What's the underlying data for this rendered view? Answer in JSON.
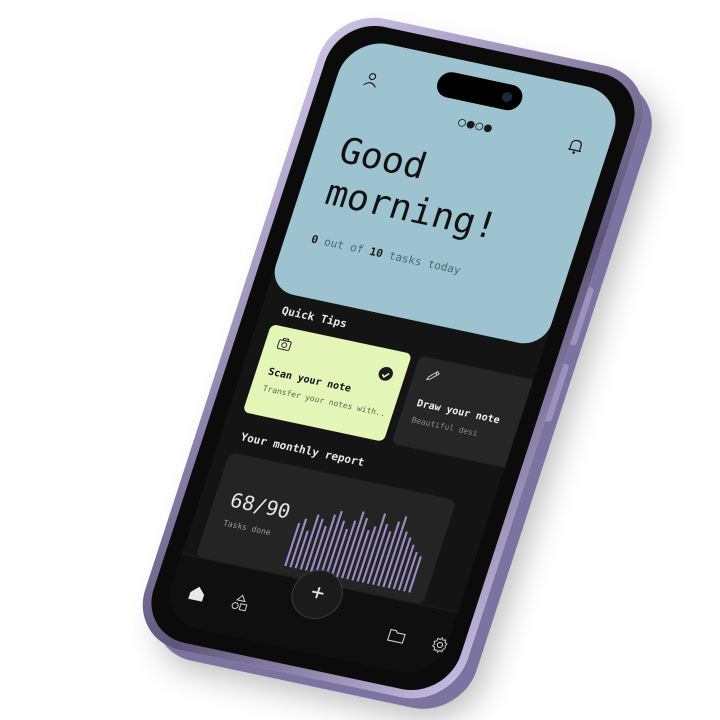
{
  "header": {
    "greeting": "Good morning!",
    "tasks_done": "0",
    "tasks_mid": " out of ",
    "tasks_total": "10",
    "tasks_suffix": " tasks today",
    "status_dots": "○●○●"
  },
  "quick_tips": {
    "title": "Quick Tips",
    "cards": [
      {
        "title": "Scan your note",
        "description": "Transfer your notes with..",
        "icon": "camera-icon",
        "done": true
      },
      {
        "title": "Draw your note",
        "description": "Beautiful desi",
        "icon": "pen-icon",
        "done": false
      }
    ]
  },
  "monthly_report": {
    "title": "Your monthly report",
    "value": "68/90",
    "label": "Tasks done",
    "bars": [
      0.55,
      0.62,
      0.48,
      0.7,
      0.66,
      0.58,
      0.74,
      0.8,
      0.69,
      0.6,
      0.72,
      0.85,
      0.78,
      0.64,
      0.7,
      0.88,
      0.76,
      0.68,
      0.82,
      0.9,
      0.72,
      0.66,
      0.58,
      0.5,
      0.46
    ]
  },
  "nav": {
    "items": [
      "home-icon",
      "shapes-icon",
      "add-icon",
      "folder-icon",
      "settings-icon"
    ],
    "fab_label": "+"
  },
  "colors": {
    "header_bg": "#9ec3d0",
    "tip_primary_bg": "#e4f5b8",
    "bar_color": "#9a8fc4",
    "phone_frame": "#8f86ad"
  }
}
